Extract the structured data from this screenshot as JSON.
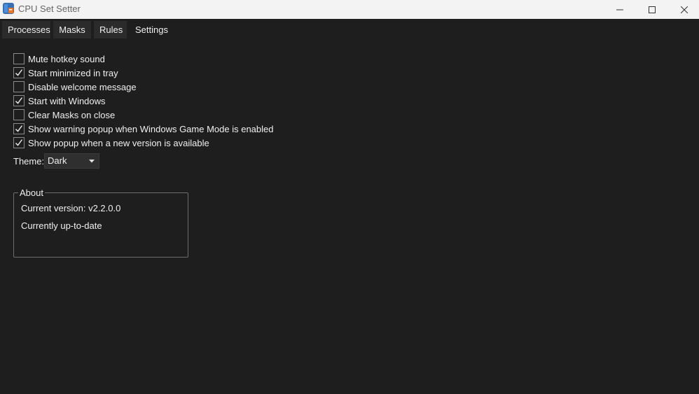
{
  "window": {
    "title": "CPU Set Setter",
    "icon": "app-icon"
  },
  "tabs": [
    {
      "label": "Processes",
      "active": false
    },
    {
      "label": "Masks",
      "active": false
    },
    {
      "label": "Rules",
      "active": false
    },
    {
      "label": "Settings",
      "active": true
    }
  ],
  "settings": {
    "options": [
      {
        "label": "Mute hotkey sound",
        "checked": false
      },
      {
        "label": "Start minimized in tray",
        "checked": true
      },
      {
        "label": "Disable welcome message",
        "checked": false
      },
      {
        "label": "Start with Windows",
        "checked": true
      },
      {
        "label": "Clear Masks on close",
        "checked": false
      },
      {
        "label": "Show warning popup when Windows Game Mode is enabled",
        "checked": true
      },
      {
        "label": "Show popup when a new version is available",
        "checked": true
      }
    ],
    "theme_label": "Theme:",
    "theme_value": "Dark"
  },
  "about": {
    "title": "About",
    "version_text": "Current version: v2.2.0.0",
    "status_text": "Currently up-to-date"
  },
  "colors": {
    "background": "#1e1e1e",
    "titlebar": "#f3f3f3",
    "tab_bg": "#2b2b2b"
  }
}
